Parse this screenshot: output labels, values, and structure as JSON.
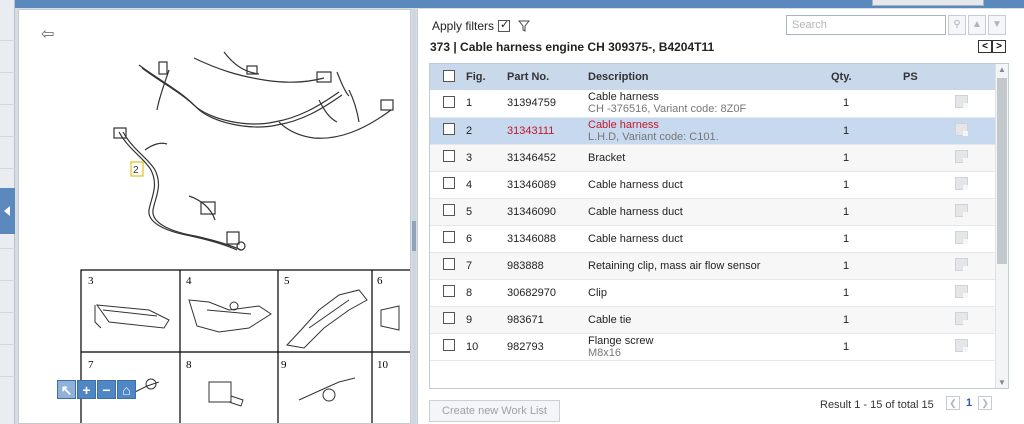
{
  "filters": {
    "apply_label": "Apply filters",
    "checked": true
  },
  "search": {
    "placeholder": "Search"
  },
  "heading": "373 | Cable harness engine  CH 309375-, B4204T11",
  "nav": {
    "prev": "<",
    "next": ">"
  },
  "table": {
    "headers": {
      "fig": "Fig.",
      "part_no": "Part No.",
      "description": "Description",
      "qty": "Qty.",
      "ps": "PS"
    },
    "rows": [
      {
        "fig": "1",
        "part_no": "31394759",
        "desc": "Cable harness",
        "desc2": "CH -376516, Variant code: 8Z0F",
        "qty": "1"
      },
      {
        "fig": "2",
        "part_no": "31343111",
        "desc": "Cable harness",
        "desc2": "L.H.D, Variant code: C101.",
        "qty": "1"
      },
      {
        "fig": "3",
        "part_no": "31346452",
        "desc": "Bracket",
        "desc2": "",
        "qty": "1"
      },
      {
        "fig": "4",
        "part_no": "31346089",
        "desc": "Cable harness duct",
        "desc2": "",
        "qty": "1"
      },
      {
        "fig": "5",
        "part_no": "31346090",
        "desc": "Cable harness duct",
        "desc2": "",
        "qty": "1"
      },
      {
        "fig": "6",
        "part_no": "31346088",
        "desc": "Cable harness duct",
        "desc2": "",
        "qty": "1"
      },
      {
        "fig": "7",
        "part_no": "983888",
        "desc": "Retaining clip, mass air flow sensor",
        "desc2": "",
        "qty": "1"
      },
      {
        "fig": "8",
        "part_no": "30682970",
        "desc": "Clip",
        "desc2": "",
        "qty": "1"
      },
      {
        "fig": "9",
        "part_no": "983671",
        "desc": "Cable tie",
        "desc2": "",
        "qty": "1"
      },
      {
        "fig": "10",
        "part_no": "982793",
        "desc": "Flange screw",
        "desc2": "M8x16",
        "qty": "1"
      }
    ]
  },
  "footer": {
    "create_worklist": "Create new Work List",
    "result_text": "Result 1 - 15 of total 15",
    "page": "1"
  },
  "illustration": {
    "callout": "2",
    "grid_labels": [
      "3",
      "4",
      "5",
      "6",
      "7",
      "8",
      "9",
      "10"
    ]
  },
  "colors": {
    "accent": "#5b89bd",
    "header_row": "#c9d9eb",
    "selected_row": "#c6d9ef",
    "selected_text": "#c4182c"
  }
}
